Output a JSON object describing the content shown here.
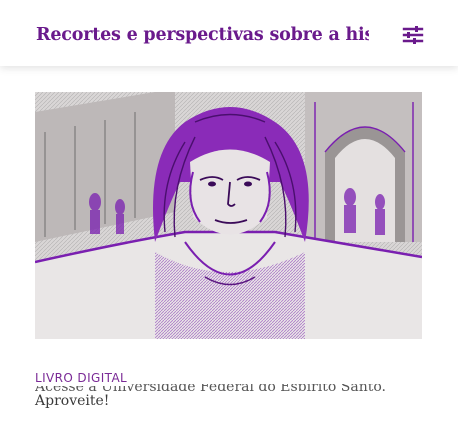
{
  "header": {
    "title": "Recortes e perspectivas sobre a hist",
    "menu_icon": "sliders-icon"
  },
  "hero": {
    "image_description_icon": "portrait-engraving-icon"
  },
  "post": {
    "category": "LIVRO DIGITAL",
    "text_partial": "Acesse a Universidade Federal do Espirito Santo.",
    "text": "Aproveite!"
  },
  "colors": {
    "accent": "#6a1a8c",
    "purple_tint": "#8a2bb8"
  }
}
